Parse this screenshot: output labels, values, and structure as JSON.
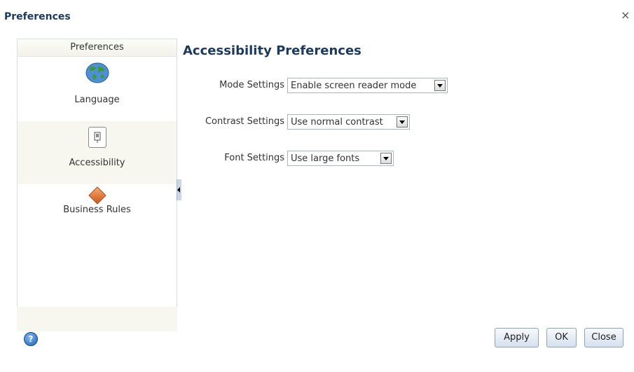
{
  "dialog": {
    "title": "Preferences",
    "close_glyph": "×"
  },
  "sidebar": {
    "header": "Preferences",
    "items": [
      {
        "label": "Language",
        "icon": "globe-icon",
        "selected": false
      },
      {
        "label": "Accessibility",
        "icon": "accessibility-icon",
        "selected": true
      },
      {
        "label": "Business Rules",
        "icon": "diamond-icon",
        "selected": false
      }
    ]
  },
  "main": {
    "heading": "Accessibility Preferences",
    "settings": [
      {
        "label": "Mode Settings",
        "value": "Enable screen reader mode"
      },
      {
        "label": "Contrast Settings",
        "value": "Use normal contrast"
      },
      {
        "label": "Font Settings",
        "value": "Use large fonts"
      }
    ]
  },
  "footer": {
    "help_glyph": "?",
    "apply_label": "Apply",
    "ok_label": "OK",
    "close_label": "Close"
  },
  "colors": {
    "title": "#1c3a5e",
    "button_border": "#8da3ba",
    "selected_bg": "#f7f7ef"
  }
}
